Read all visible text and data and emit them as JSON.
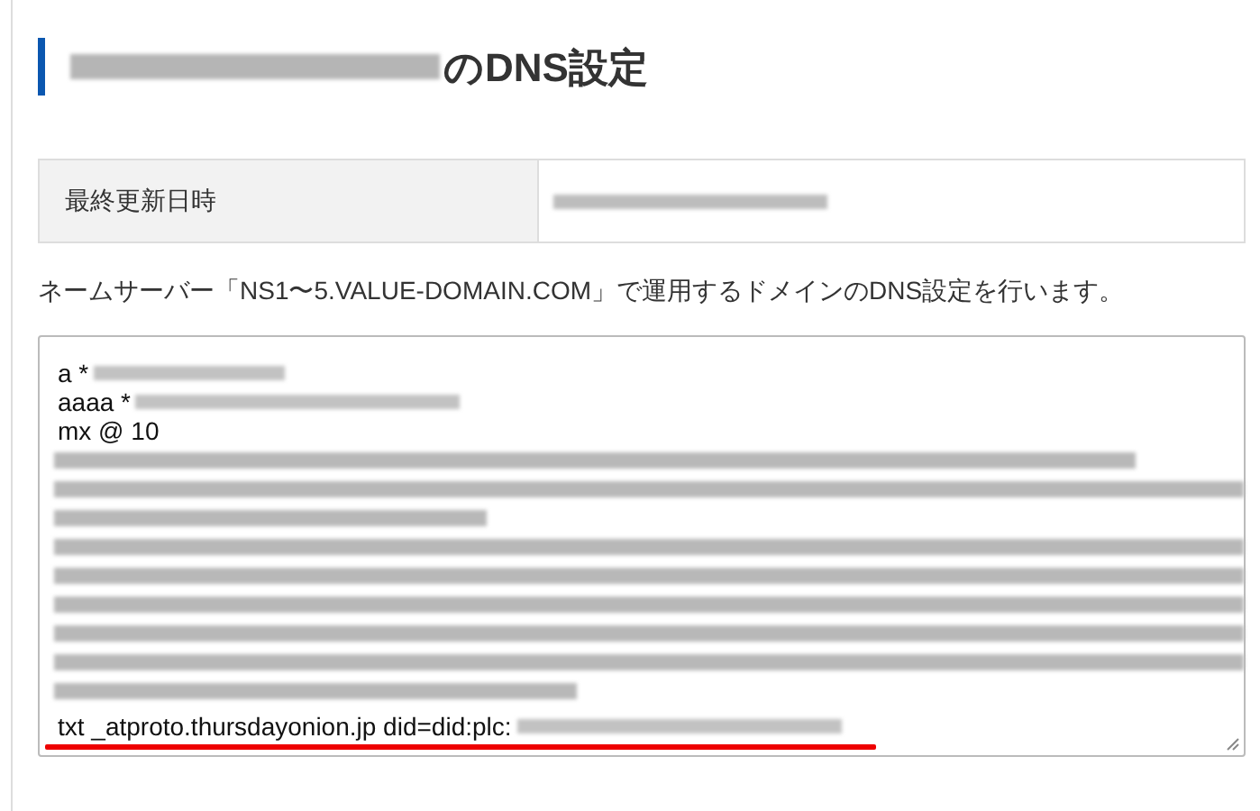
{
  "heading": {
    "title": "のDNS設定"
  },
  "info_table": {
    "rows": [
      {
        "label": "最終更新日時"
      }
    ]
  },
  "description": "ネームサーバー「NS1〜5.VALUE-DOMAIN.COM」で運用するドメインのDNS設定を行います。",
  "records_field": {
    "lines": [
      {
        "kind": "text",
        "text": "a *"
      },
      {
        "kind": "text",
        "text": "aaaa *"
      },
      {
        "kind": "text",
        "text": "mx @ 10"
      },
      {
        "kind": "redacted"
      },
      {
        "kind": "redacted"
      },
      {
        "kind": "redacted"
      },
      {
        "kind": "redacted"
      },
      {
        "kind": "redacted"
      },
      {
        "kind": "redacted"
      },
      {
        "kind": "redacted"
      },
      {
        "kind": "redacted"
      },
      {
        "kind": "redacted"
      },
      {
        "kind": "text",
        "text": "txt _atproto.thursdayonion.jp did=did:plc:",
        "underlined": true
      }
    ]
  }
}
